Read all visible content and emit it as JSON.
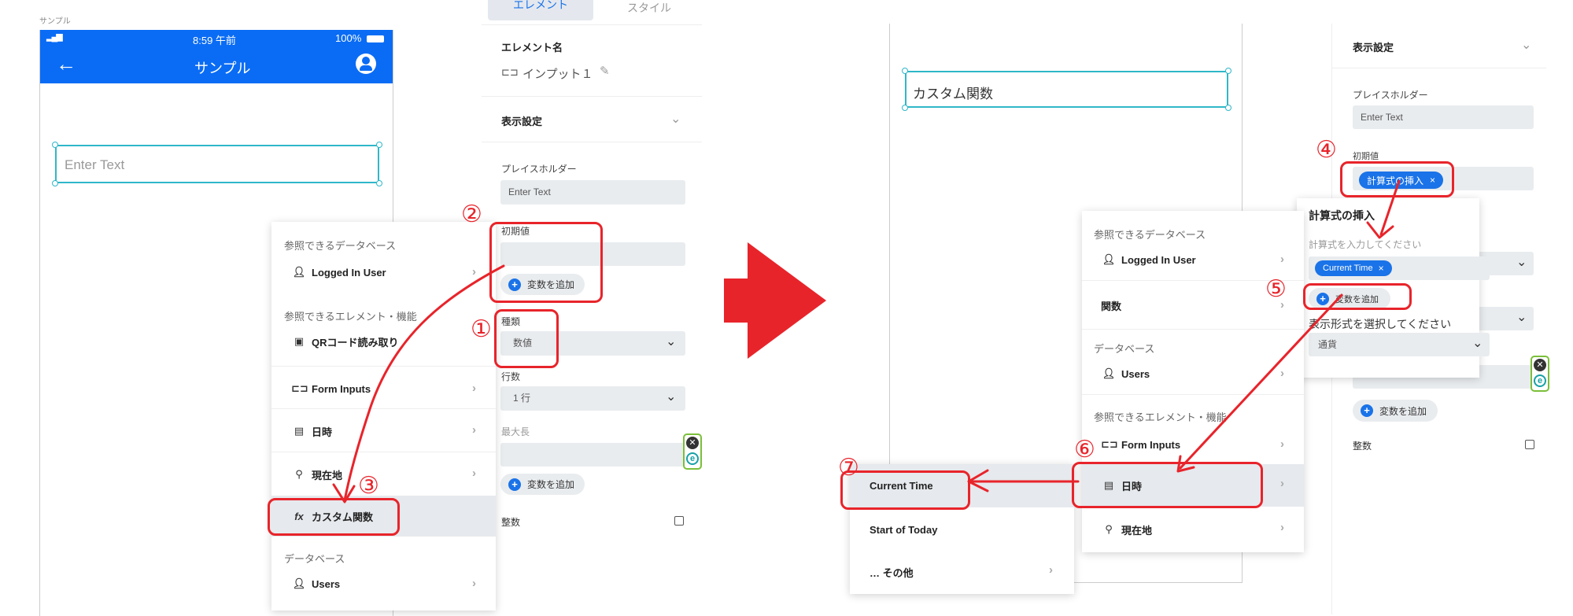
{
  "left": {
    "screen_label": "サンプル",
    "status_time": "8:59 午前",
    "status_battery": "100%",
    "header_title": "サンプル",
    "input_placeholder": "Enter Text"
  },
  "panel": {
    "tab_element": "エレメント",
    "tab_style": "スタイル",
    "element_name_label": "エレメント名",
    "element_name_value": "インプット１",
    "display_settings": "表示設定",
    "placeholder_label": "プレイスホルダー",
    "placeholder_value": "Enter Text",
    "initial_label": "初期値",
    "add_variable": "変数を追加",
    "type_label": "種類",
    "type_value": "数値",
    "rows_label": "行数",
    "rows_value": "1 行",
    "maxlen_label": "最大長",
    "integer_label": "整数"
  },
  "menu1": {
    "head_db": "参照できるデータベース",
    "logged_in": "Logged In User",
    "head_elements": "参照できるエレメント・機能",
    "qr": "QRコード読み取り",
    "form_inputs": "Form Inputs",
    "datetime": "日時",
    "location": "現在地",
    "custom_func": "カスタム関数",
    "head_database": "データベース",
    "users": "Users"
  },
  "right": {
    "canvas_text": "カスタム関数",
    "display_settings": "表示設定",
    "placeholder_label": "プレイスホルダー",
    "placeholder_value": "Enter Text",
    "initial_label": "初期値",
    "formula_chip": "計算式の挿入",
    "popup_title": "計算式の挿入",
    "popup_hint": "計算式を入力してください",
    "current_time_chip": "Current Time",
    "add_variable": "変数を追加",
    "format_label": "表示形式を選択してください",
    "format_value": "通貨",
    "add_variable2": "変数を追加",
    "integer_label": "整数"
  },
  "menu2": {
    "head_db": "参照できるデータベース",
    "logged_in": "Logged In User",
    "functions": "関数",
    "head_database": "データベース",
    "users": "Users",
    "head_elements": "参照できるエレメント・機能",
    "form_inputs": "Form Inputs",
    "datetime": "日時",
    "location": "現在地"
  },
  "menu3": {
    "current_time": "Current Time",
    "start_of_today": "Start of Today",
    "other": "… その他"
  },
  "steps": [
    "①",
    "②",
    "③",
    "④",
    "⑤",
    "⑥",
    "⑦"
  ],
  "colors": {
    "accent_blue": "#0a6cf5",
    "annotation_red": "#e8242b",
    "cyan_select": "#2fb7c8"
  }
}
